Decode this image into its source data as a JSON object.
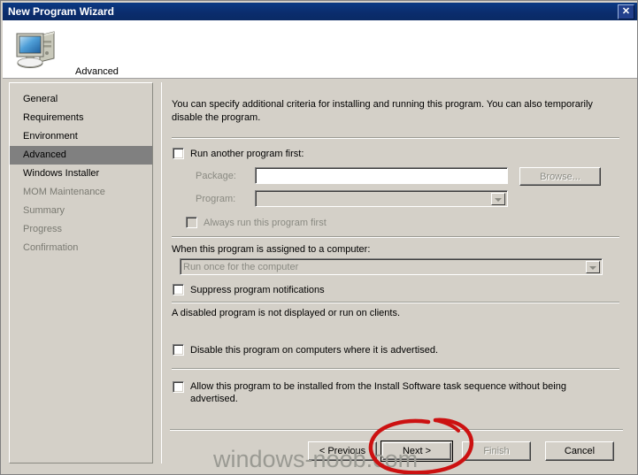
{
  "window": {
    "title": "New Program Wizard",
    "close_label": "✕"
  },
  "header": {
    "page_title": "Advanced",
    "icon": "computer-icon"
  },
  "sidebar": {
    "items": [
      {
        "label": "General",
        "state": "normal"
      },
      {
        "label": "Requirements",
        "state": "normal"
      },
      {
        "label": "Environment",
        "state": "normal"
      },
      {
        "label": "Advanced",
        "state": "selected"
      },
      {
        "label": "Windows Installer",
        "state": "normal"
      },
      {
        "label": "MOM Maintenance",
        "state": "dim"
      },
      {
        "label": "Summary",
        "state": "dim"
      },
      {
        "label": "Progress",
        "state": "dim"
      },
      {
        "label": "Confirmation",
        "state": "dim"
      }
    ]
  },
  "content": {
    "intro": "You can specify additional criteria for installing and running this program. You can also temporarily disable the program.",
    "run_another_program_first": {
      "label": "Run another program first:",
      "checked": false
    },
    "package": {
      "label": "Package:",
      "value": "",
      "disabled": true
    },
    "program": {
      "label": "Program:",
      "value": "",
      "disabled": true
    },
    "browse_button": {
      "label": "Browse...",
      "disabled": true
    },
    "always_run_first": {
      "label": "Always run this program first",
      "checked": false,
      "disabled": true
    },
    "assigned_label": "When this program is assigned to a computer:",
    "assigned_select": {
      "value": "Run once for the computer",
      "disabled": true
    },
    "suppress_notifications": {
      "label": "Suppress program notifications",
      "checked": false
    },
    "disabled_note": "A disabled program is not displayed or run on clients.",
    "disable_on_computers": {
      "label": "Disable this program on computers where it is advertised.",
      "checked": false
    },
    "allow_task_sequence": {
      "label": "Allow this program to be installed from the Install Software task sequence without being advertised.",
      "checked": false
    }
  },
  "buttons": {
    "previous": "< Previous",
    "next": "Next >",
    "finish": "Finish",
    "cancel": "Cancel"
  },
  "watermark": "windows-noob.com",
  "colors": {
    "titlebar": "#0b2d6e",
    "dialog_face": "#d4d0c8",
    "selection": "#808080",
    "annotation": "#cc1111",
    "watermark": "#9a9a93"
  }
}
